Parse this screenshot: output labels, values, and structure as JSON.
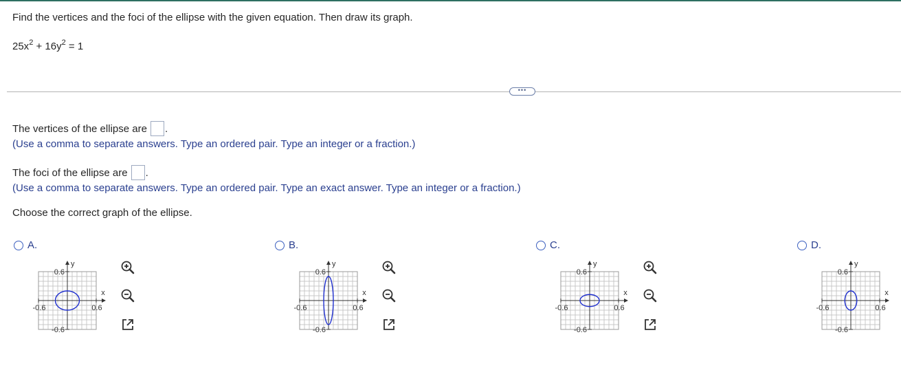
{
  "question": {
    "text": "Find the vertices and the foci of the ellipse with the given equation. Then draw its graph.",
    "equation": {
      "term1": "25x",
      "exp1": "2",
      "plus": " + 16y",
      "exp2": "2",
      "rhs": " = 1"
    }
  },
  "more_button": "•••",
  "vertices": {
    "prompt": "The vertices of the ellipse are",
    "hint": "(Use a comma to separate answers. Type an ordered pair. Type an integer or a fraction.)"
  },
  "foci": {
    "prompt": "The foci of the ellipse are",
    "hint": "(Use a comma to separate answers. Type an ordered pair. Type an exact answer. Type an integer or a fraction.)"
  },
  "choose": "Choose the correct graph of the ellipse.",
  "options": [
    {
      "label": "A.",
      "rx": 0.25,
      "ry": 0.2,
      "x_min": "-0.6",
      "x_max": "0.6",
      "y_max": "0.6",
      "y_min": "-0.6",
      "x_axis": "x",
      "y_axis": "y"
    },
    {
      "label": "B.",
      "rx": 0.1,
      "ry": 0.5,
      "x_min": "-0.6",
      "x_max": "0.6",
      "y_max": "0.6",
      "y_min": "-0.6",
      "x_axis": "x",
      "y_axis": "y"
    },
    {
      "label": "C.",
      "rx": 0.2,
      "ry": 0.125,
      "x_min": "-0.6",
      "x_max": "0.6",
      "y_max": "0.6",
      "y_min": "-0.6",
      "x_axis": "x",
      "y_axis": "y"
    },
    {
      "label": "D.",
      "rx": 0.125,
      "ry": 0.2,
      "x_min": "-0.6",
      "x_max": "0.6",
      "y_max": "0.6",
      "y_min": "-0.6",
      "x_axis": "x",
      "y_axis": "y"
    }
  ],
  "icons": {
    "zoom_in": "zoom-in-icon",
    "zoom_out": "zoom-out-icon",
    "popout": "popout-icon"
  },
  "colors": {
    "ellipse": "#1f2fcf",
    "grid": "#c8c8c8",
    "axis": "#333333",
    "hint_text": "#2a3f8f",
    "radio": "#3b5fbf"
  }
}
